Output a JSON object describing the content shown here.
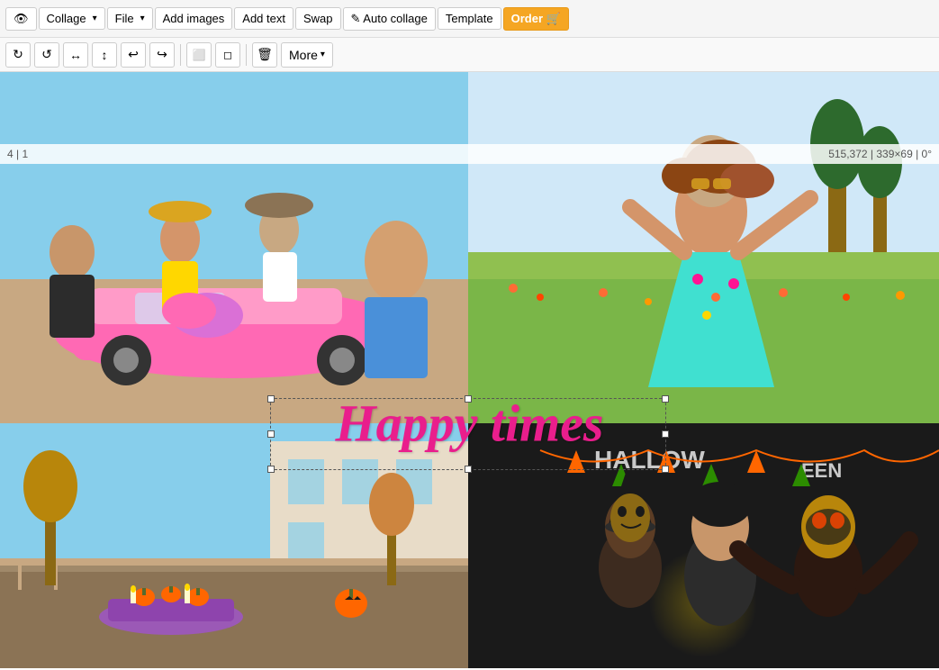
{
  "topToolbar": {
    "eyeLabel": "👁",
    "collageLabel": "Collage",
    "fileLabel": "File",
    "addImagesLabel": "Add images",
    "addTextLabel": "Add text",
    "swapLabel": "Swap",
    "autoCollageLabel": "✎ Auto collage",
    "templateLabel": "Template",
    "orderLabel": "Order 🛒"
  },
  "secondToolbar": {
    "btn1": "↺",
    "btn2": "↻",
    "btn3": "↺",
    "btn4": "↻",
    "btn5": "↩",
    "btn6": "↪",
    "btn7": "▭",
    "btn8": "▭",
    "btn9": "🗑",
    "moreLabel": "More"
  },
  "statusBar": {
    "left": "4 | 1",
    "right": "515,372 | 339×69 | 0°"
  },
  "canvas": {
    "happyTimesText": "Happy times"
  }
}
